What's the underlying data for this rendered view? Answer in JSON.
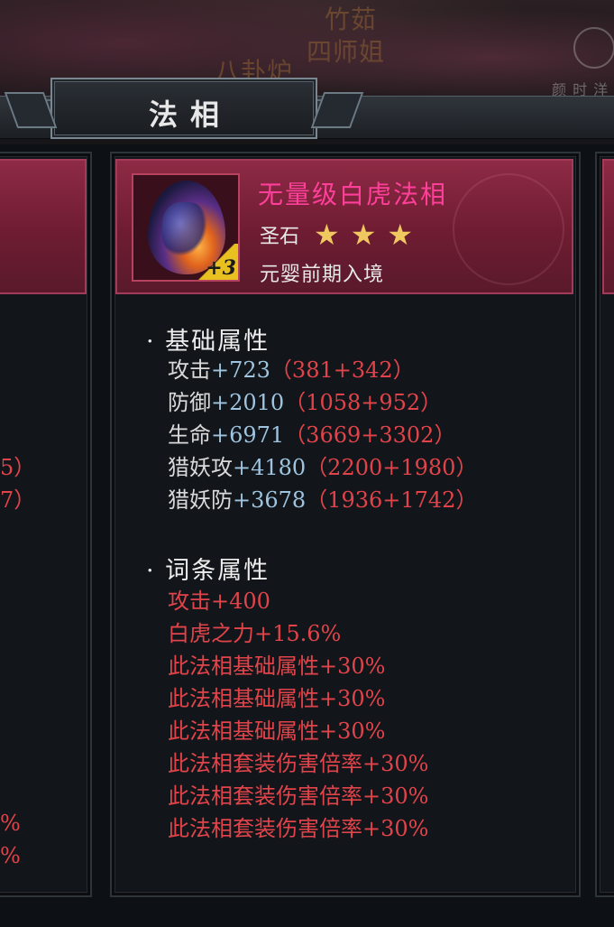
{
  "scene": {
    "labels": [
      "竹茹",
      "四师姐",
      "八卦炉",
      "颜 时 洋"
    ]
  },
  "header": {
    "title": "法相"
  },
  "card": {
    "name": "无量级白虎法相",
    "level_badge": "+3",
    "grade_label": "圣石",
    "stars": [
      "★",
      "★",
      "★"
    ],
    "stage": "元婴前期入境"
  },
  "sections": {
    "base_title": "· 基础属性",
    "affix_title": "· 词条属性"
  },
  "base_stats": [
    {
      "name": "攻击",
      "value": "+723",
      "detail": "（381+342）"
    },
    {
      "name": "防御",
      "value": "+2010",
      "detail": "（1058+952）"
    },
    {
      "name": "生命",
      "value": "+6971",
      "detail": "（3669+3302）"
    },
    {
      "name": "猎妖攻",
      "value": "+4180",
      "detail": "（2200+1980）"
    },
    {
      "name": "猎妖防",
      "value": "+3678",
      "detail": "（1936+1742）"
    }
  ],
  "affix_stats": [
    "攻击+400",
    "白虎之力+15.6%",
    "此法相基础属性+30%",
    "此法相基础属性+30%",
    "此法相基础属性+30%",
    "此法相套装伤害倍率+30%",
    "此法相套装伤害倍率+30%",
    "此法相套装伤害倍率+30%"
  ],
  "left_fragments": [
    "5）",
    "7）",
    "%",
    "%"
  ],
  "colors": {
    "name": "#ff3f9a",
    "stat_value": "#9ec4e0",
    "stat_detail": "#e0444a",
    "star": "#f0c860",
    "banner": "#8e2a45"
  }
}
